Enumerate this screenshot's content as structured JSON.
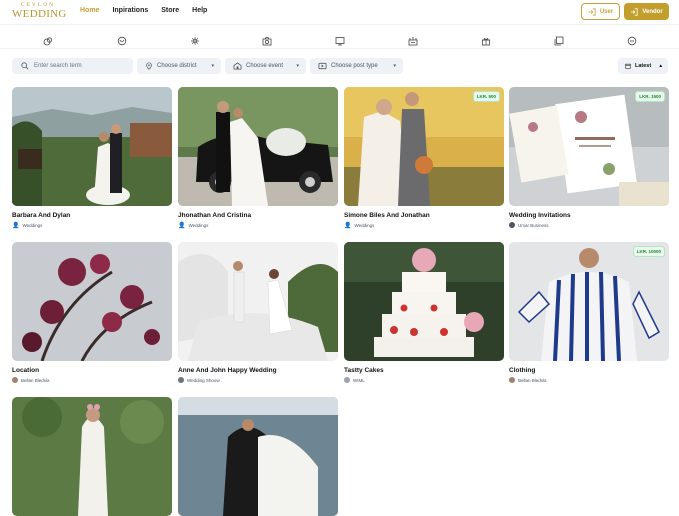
{
  "logo": {
    "line1": "CEYLON",
    "line2": "WEDDING"
  },
  "nav": {
    "home": "Home",
    "inspirations": "Inpirations",
    "store": "Store",
    "help": "Help"
  },
  "auth": {
    "user": "User",
    "vendor": "Vendor"
  },
  "categories": [
    "rings-icon",
    "cake-icon",
    "flower-icon",
    "camera-icon",
    "monitor-icon",
    "venue-icon",
    "gift-icon",
    "cards-icon",
    "more-icon"
  ],
  "filters": {
    "search_placeholder": "Enter search term",
    "district": "Choose district",
    "event": "Choose event",
    "post_type": "Choose post type",
    "sort": "Latest"
  },
  "colors": {
    "accent": "#c29e2c",
    "nav_active": "#c8a032",
    "price_badge": "#1f8a3a"
  },
  "cards": [
    {
      "title": "Barbara And Dylan",
      "author": "Weddings",
      "price": ""
    },
    {
      "title": "Jhonathan And Cristina",
      "author": "Weddings",
      "price": ""
    },
    {
      "title": "Simone Biles And Jonathan",
      "author": "Weddings",
      "price": "LKR. 500"
    },
    {
      "title": "Wedding Invitations",
      "author": "Umar Business",
      "price": "LKR. 1500"
    },
    {
      "title": "Location",
      "author": "Bellan Bledsla",
      "price": ""
    },
    {
      "title": "Anne And John Happy Wedding",
      "author": "Wedding Shoow",
      "price": ""
    },
    {
      "title": "Tastty Cakes",
      "author": "WIML",
      "price": ""
    },
    {
      "title": "Clothing",
      "author": "Bellan Bledsla",
      "price": "LKR. 10000"
    }
  ]
}
